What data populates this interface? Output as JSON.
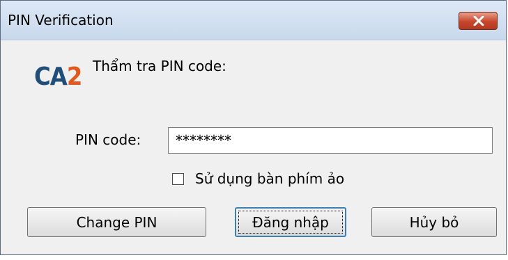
{
  "window": {
    "title": "PIN Verification",
    "close_icon": "close-icon"
  },
  "logo": {
    "ca": "CA",
    "num": "2"
  },
  "prompt": "Thẩm tra PIN code:",
  "pin": {
    "label": "PIN code:",
    "value": "********"
  },
  "virtual_keyboard": {
    "label": "Sử dụng bàn phím ảo",
    "checked": false
  },
  "buttons": {
    "change_pin": "Change PIN",
    "login": "Đăng nhập",
    "cancel": "Hủy bỏ"
  },
  "colors": {
    "logo_ca": "#1f4e79",
    "logo_num": "#e05a1f",
    "close_button": "#c7452b"
  }
}
